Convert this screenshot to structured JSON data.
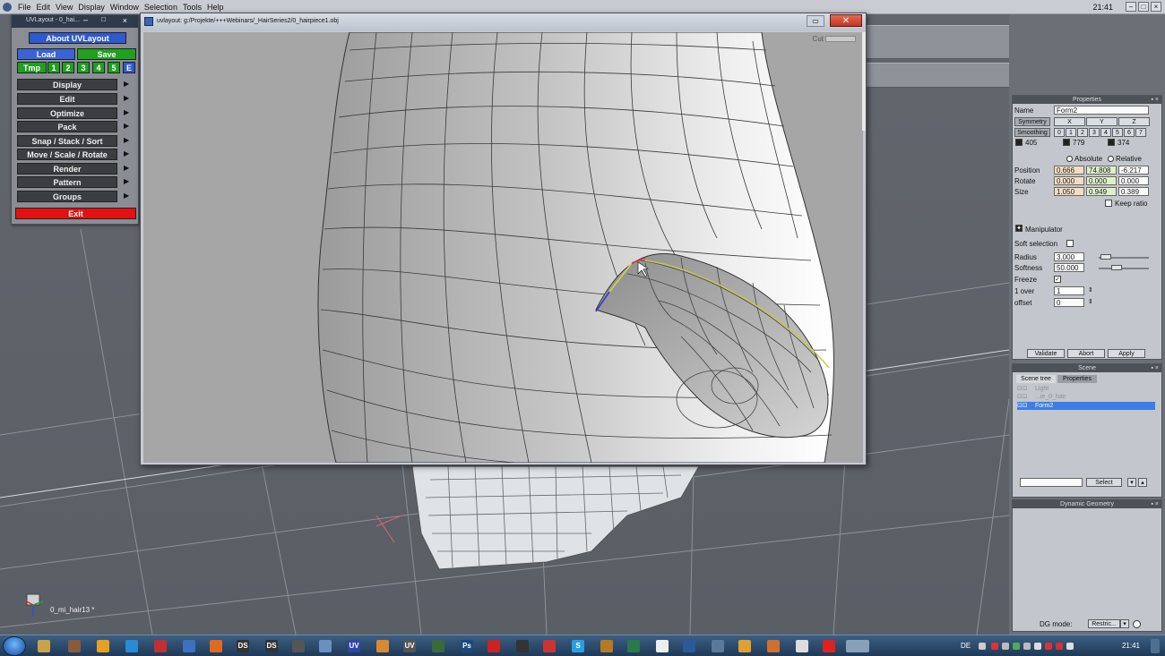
{
  "menubar": {
    "items": [
      "File",
      "Edit",
      "View",
      "Display",
      "Window",
      "Selection",
      "Tools",
      "Help"
    ],
    "clock": "21:41"
  },
  "uvtoolbar": {
    "title": "UVLayout - 0_hai...",
    "about_label": "About UVLayout",
    "load_label": "Load",
    "save_label": "Save",
    "tmp_label": "Tmp",
    "slots": [
      "1",
      "2",
      "3",
      "4",
      "5"
    ],
    "e_label": "E",
    "menu_items": [
      "Display",
      "Edit",
      "Optimize",
      "Pack",
      "Snap / Stack / Sort",
      "Move / Scale / Rotate",
      "Render",
      "Pattern",
      "Groups"
    ],
    "exit_label": "Exit"
  },
  "mainwindow": {
    "title": "uvlayout: g:/Projekte/+++Webinars/_HairSeries2/0_hairpiece1.obj",
    "cut_label": "Cut"
  },
  "viewport": {
    "object_label": "0_mi_hair13 *"
  },
  "properties": {
    "header": "Properties",
    "name_label": "Name",
    "name_value": "Form2",
    "symmetry_label": "Symmetry",
    "axes": [
      "X",
      "Y",
      "Z"
    ],
    "smoothing_label": "Smoothing",
    "smoothing_levels": [
      "0",
      "1",
      "2",
      "3",
      "4",
      "5",
      "6",
      "7"
    ],
    "counts": [
      "405",
      "779",
      "374"
    ],
    "absolute_label": "Absolute",
    "relative_label": "Relative",
    "position_label": "Position",
    "position": [
      "0.666",
      "74.808",
      "-6.217"
    ],
    "rotate_label": "Rotate",
    "rotate": [
      "0.000",
      "0.000",
      "0.000"
    ],
    "size_label": "Size",
    "size": [
      "1.050",
      "0.949",
      "0.389"
    ],
    "keep_ratio_label": "Keep ratio",
    "manipulator_label": "Manipulator",
    "soft_selection_label": "Soft selection",
    "radius_label": "Radius",
    "radius_value": "3.000",
    "softness_label": "Softness",
    "softness_value": "50.000",
    "freeze_label": "Freeze",
    "over_label": "1 over",
    "over_value": "1",
    "offset_label": "offset",
    "offset_value": "0",
    "validate_label": "Validate",
    "abort_label": "Abort",
    "apply_label": "Apply"
  },
  "scene": {
    "header": "Scene",
    "tabs": [
      "Scene tree",
      "Properties"
    ],
    "rows": [
      "Light",
      "...ie_0_hair",
      "Form2"
    ],
    "select_label": "Select"
  },
  "dynamic": {
    "header": "Dynamic Geometry",
    "dg_mode_label": "DG mode:",
    "dg_mode_value": "Restric..."
  },
  "taskbar": {
    "lang": "DE",
    "time": "21:41"
  },
  "colors": {
    "uv_blue": "#2e59d1",
    "uv_green": "#1ea11e",
    "uv_exit": "#e41111",
    "selection": "#3d7ee6"
  }
}
